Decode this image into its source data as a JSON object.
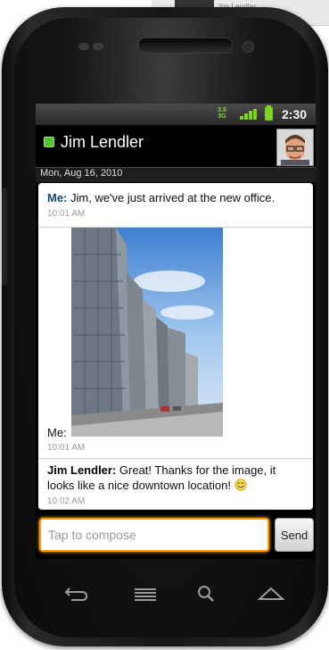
{
  "background_label": "Jim Lendler",
  "status_bar": {
    "network_top": "3.5",
    "network": "3G",
    "time": "2:30"
  },
  "conversation": {
    "contact_name": "Jim Lendler",
    "presence_color": "#56c32c",
    "date": "Mon, Aug 16, 2010"
  },
  "messages": [
    {
      "sender": "Me:",
      "text": " Jim, we've just arrived at the new office.",
      "time": "10:01 AM"
    },
    {
      "sender": "Me:",
      "attachment": "photo",
      "time": "10:01 AM"
    },
    {
      "sender": "Jim Lendler:",
      "text": " Great! Thanks for the image, it looks like a nice downtown location!",
      "emoji": "smiley",
      "time": "10:02 AM"
    }
  ],
  "compose": {
    "placeholder": "Tap to compose",
    "send_label": "Send",
    "focus_color": "#ff9a00"
  },
  "softkeys": [
    "back-icon",
    "menu-icon",
    "search-icon",
    "home-icon"
  ]
}
